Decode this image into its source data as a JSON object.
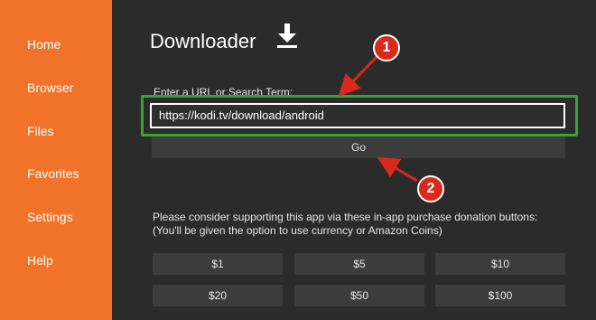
{
  "sidebar": {
    "items": [
      {
        "label": "Home"
      },
      {
        "label": "Browser"
      },
      {
        "label": "Files"
      },
      {
        "label": "Favorites"
      },
      {
        "label": "Settings"
      },
      {
        "label": "Help"
      }
    ]
  },
  "header": {
    "title": "Downloader",
    "icon": "download-icon"
  },
  "url": {
    "label": "Enter a URL or Search Term:",
    "value": "https://kodi.tv/download/android"
  },
  "go_label": "Go",
  "donation": {
    "text_line1": "Please consider supporting this app via these in-app purchase donation buttons:",
    "text_line2": "(You'll be given the option to use currency or Amazon Coins)",
    "buttons": [
      "$1",
      "$5",
      "$10",
      "$20",
      "$50",
      "$100"
    ]
  },
  "annotations": {
    "badge1": "1",
    "badge2": "2"
  },
  "colors": {
    "sidebar": "#f1732a",
    "background": "#2b2b2b",
    "highlight": "#3aa335",
    "annotation": "#d9291b"
  }
}
